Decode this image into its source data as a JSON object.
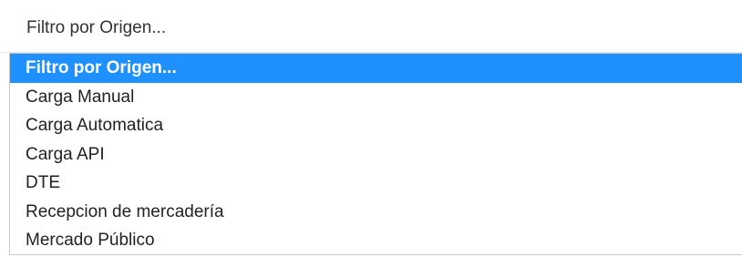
{
  "select": {
    "value": "Filtro por Origen..."
  },
  "dropdown": {
    "options": [
      {
        "label": "Filtro por Origen...",
        "selected": true
      },
      {
        "label": "Carga Manual",
        "selected": false
      },
      {
        "label": "Carga Automatica",
        "selected": false
      },
      {
        "label": "Carga API",
        "selected": false
      },
      {
        "label": "DTE",
        "selected": false
      },
      {
        "label": "Recepcion de mercadería",
        "selected": false
      },
      {
        "label": "Mercado Público",
        "selected": false
      }
    ]
  },
  "colors": {
    "highlight": "#1e90ff",
    "text": "#222222"
  }
}
